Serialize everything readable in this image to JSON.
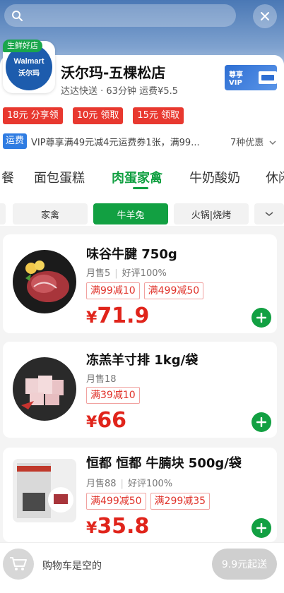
{
  "colors": {
    "brand_green": "#12a042",
    "price_red": "#e0241b",
    "coupon_red": "#e8382f",
    "freight_blue": "#2f7ce2"
  },
  "header": {
    "search_icon": "search-icon",
    "close_icon": "close-icon"
  },
  "store": {
    "logo_tag": "生鲜好店",
    "logo_en": "Walmart",
    "logo_cn": "沃尔玛",
    "name": "沃尔玛-五棵松店",
    "delivery": "达达快送 · 63分钟  运费¥5.5",
    "vip_label": "尊享VIP"
  },
  "coupons": [
    {
      "label": "18元 分享领"
    },
    {
      "label": "10元 领取"
    },
    {
      "label": "15元 领取"
    }
  ],
  "freight": {
    "tag": "运费",
    "text": "VIP尊享满49元减4元运费券1张，满99...",
    "more": "7种优惠"
  },
  "categories": [
    {
      "label": "餐",
      "active": false
    },
    {
      "label": "面包蛋糕",
      "active": false
    },
    {
      "label": "肉蛋家禽",
      "active": true
    },
    {
      "label": "牛奶酸奶",
      "active": false
    },
    {
      "label": "休闲",
      "active": false
    }
  ],
  "subcategories": [
    {
      "label": "家禽",
      "active": false
    },
    {
      "label": "牛羊兔",
      "active": true
    },
    {
      "label": "火锅|烧烤",
      "active": false
    }
  ],
  "products": [
    {
      "name": "味谷牛腱 750g",
      "sales": "月售5",
      "rating": "好评100%",
      "promos": [
        "满99减10",
        "满499减50"
      ],
      "price_symbol": "¥",
      "price": "71.9"
    },
    {
      "name": "冻羔羊寸排 1kg/袋",
      "sales": "月售18",
      "rating": "",
      "promos": [
        "满39减10"
      ],
      "price_symbol": "¥",
      "price": "66"
    },
    {
      "name": "恒都 恒都 牛腩块 500g/袋",
      "sales": "月售88",
      "rating": "好评100%",
      "promos": [
        "满499减50",
        "满299减35"
      ],
      "price_symbol": "¥",
      "price": "35.8"
    }
  ],
  "cart": {
    "empty_text": "购物车是空的",
    "checkout_label": "9.9元起送"
  }
}
